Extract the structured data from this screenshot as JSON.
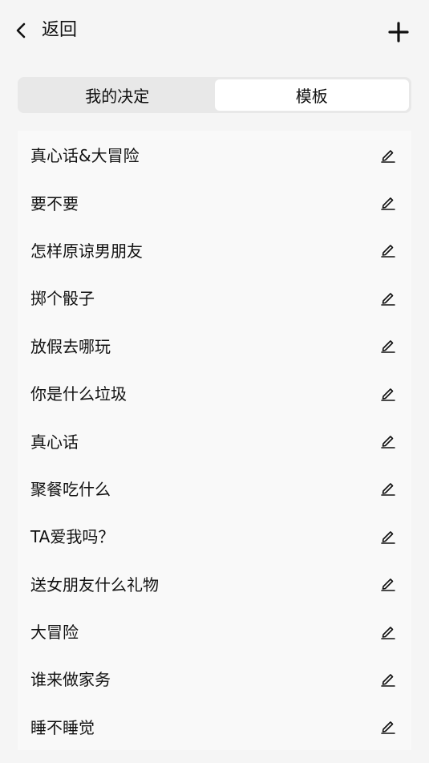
{
  "header": {
    "back_label": "返回",
    "back_icon": "chevron-left-icon",
    "add_icon": "plus-icon"
  },
  "tabs": [
    {
      "label": "我的决定",
      "active": false
    },
    {
      "label": "模板",
      "active": true
    }
  ],
  "decisions": [
    {
      "label": "真心话&大冒险",
      "icon": "edit-icon"
    },
    {
      "label": "要不要",
      "icon": "edit-icon"
    },
    {
      "label": "怎样原谅男朋友",
      "icon": "edit-icon"
    },
    {
      "label": "掷个骰子",
      "icon": "edit-icon"
    },
    {
      "label": "放假去哪玩",
      "icon": "edit-icon"
    },
    {
      "label": "你是什么垃圾",
      "icon": "edit-icon"
    },
    {
      "label": "真心话",
      "icon": "edit-icon"
    },
    {
      "label": "聚餐吃什么",
      "icon": "edit-icon"
    },
    {
      "label": "TA爱我吗？",
      "icon": "edit-icon"
    },
    {
      "label": "送女朋友什么礼物",
      "icon": "edit-icon"
    },
    {
      "label": "大冒险",
      "icon": "edit-icon"
    },
    {
      "label": "谁来做家务",
      "icon": "edit-icon"
    },
    {
      "label": "睡不睡觉",
      "icon": "edit-icon"
    }
  ],
  "colors": {
    "background": "#f5f5f5",
    "list_background": "#f9f9f9",
    "segment_track": "#e8e8e8",
    "segment_active": "#ffffff",
    "text": "#111111"
  }
}
